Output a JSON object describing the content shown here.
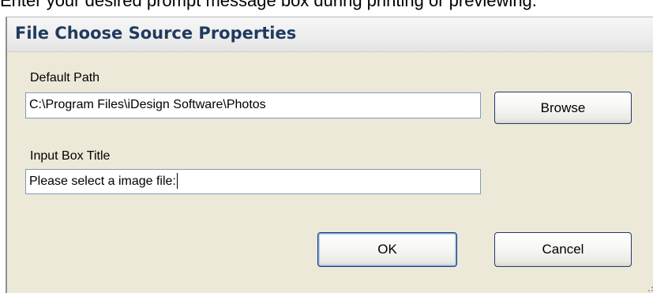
{
  "instruction_text": "Enter your desired prompt message box during printing or previewing.",
  "dialog": {
    "title": "File Choose Source Properties",
    "default_path": {
      "label": "Default Path",
      "value": "C:\\Program Files\\iDesign Software\\Photos"
    },
    "browse_label": "Browse",
    "input_box_title": {
      "label": "Input Box Title",
      "value": "Please select a image file:"
    },
    "ok_label": "OK",
    "cancel_label": "Cancel"
  },
  "colors": {
    "dialog_background": "#ece9d8",
    "title_text": "#1f3a5e",
    "textbox_border": "#7f9db9",
    "button_border": "#22386e"
  }
}
